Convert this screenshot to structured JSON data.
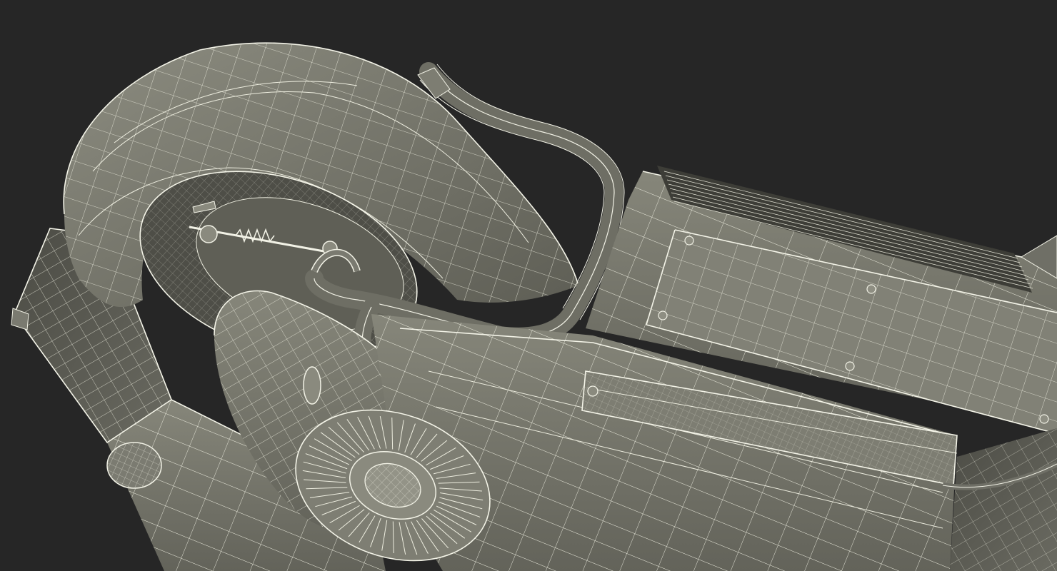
{
  "scene": {
    "background_color": "#262626",
    "mesh_fill_color": "#7f7f74",
    "mesh_dark_color": "#55554c",
    "wire_color": "#eeeee0"
  }
}
